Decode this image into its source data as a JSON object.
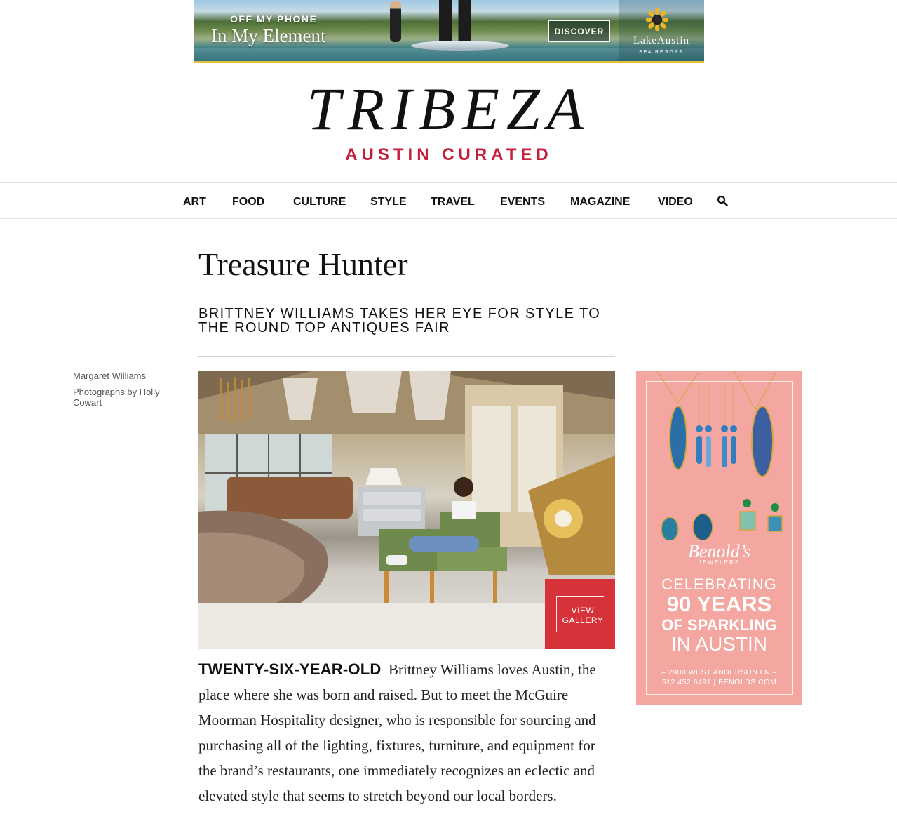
{
  "top_ad": {
    "eyebrow": "OFF MY PHONE",
    "headline": "In My Element",
    "cta": "DISCOVER",
    "brand": "LakeAustin",
    "brand_sub": "SPA RESORT",
    "accent": "#e9bd3c"
  },
  "masthead": {
    "logo": "TRIBEZA",
    "tagline": "AUSTIN CURATED",
    "tagline_color": "#c41e3a"
  },
  "nav": {
    "items": [
      {
        "label": "ART"
      },
      {
        "label": "FOOD"
      },
      {
        "label": "CULTURE"
      },
      {
        "label": "STYLE"
      },
      {
        "label": "TRAVEL"
      },
      {
        "label": "EVENTS"
      },
      {
        "label": "MAGAZINE"
      },
      {
        "label": "VIDEO"
      }
    ],
    "search_icon": "search-icon"
  },
  "article": {
    "title": "Treasure Hunter",
    "subtitle": "BRITTNEY WILLIAMS TAKES HER EYE FOR STYLE TO THE ROUND TOP ANTIQUES FAIR",
    "author": "Margaret Williams",
    "photo_credit": "Photographs by Holly Cowart",
    "gallery_label_1": "VIEW",
    "gallery_label_2": "GALLERY",
    "gallery_color": "#d6323a",
    "lead_in": "TWENTY-SIX-YEAR-OLD",
    "body": "Brittney Williams loves Austin, the place where she was born and raised. But to meet the McGuire Moorman Hospitality designer, who is responsible for sourcing and purchasing all of the lighting, fixtures, furniture, and equipment for the brand’s restaurants, one immediately recognizes an eclectic and elevated style that seems to stretch beyond our local borders."
  },
  "side_ad": {
    "brand": "Benold’s",
    "brand_sub": "JEWELERS",
    "line1": "CELEBRATING",
    "line2": "90 YEARS",
    "line3": "OF SPARKLING",
    "line4": "IN AUSTIN",
    "address": "– 2900 WEST ANDERSON LN –",
    "contact": "512.452.6491 | BENOLDS.COM",
    "bg_color": "#f4a6a0"
  }
}
